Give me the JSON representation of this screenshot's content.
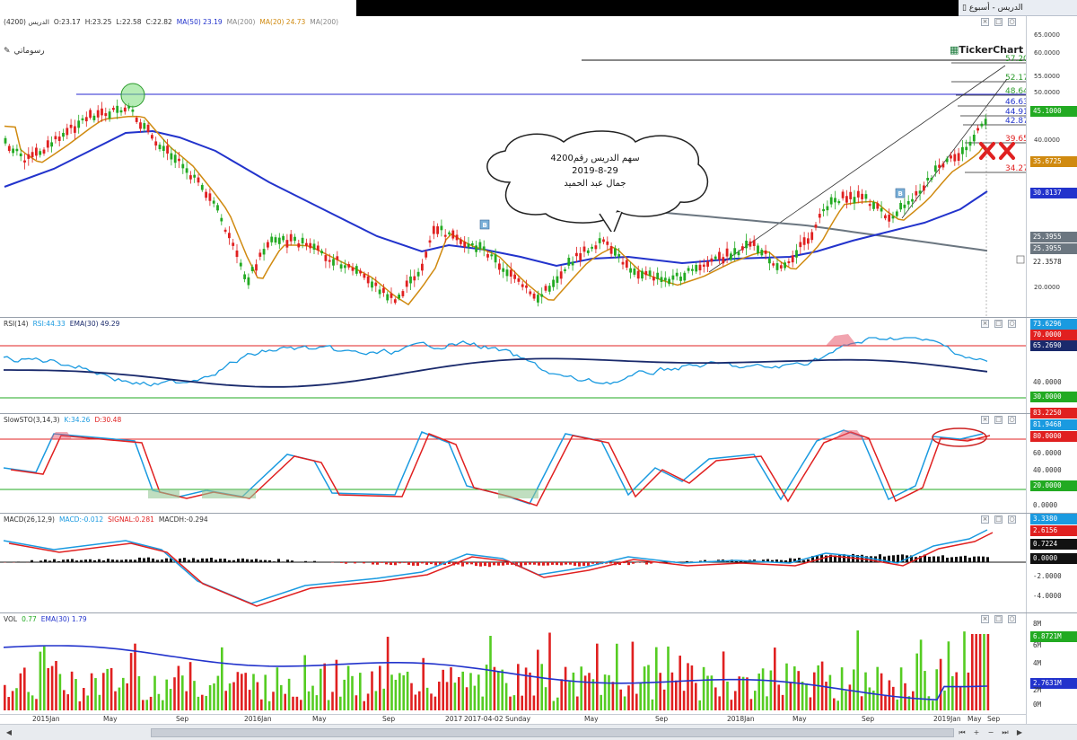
{
  "window": {
    "title": "الدريس - أسبوع",
    "logo": "TickerChart",
    "draw_label": "رسوماتي"
  },
  "price": {
    "header": [
      {
        "label": "الدريس (4200)",
        "color": "#333333"
      },
      {
        "label": "O:23.17",
        "color": "#333333"
      },
      {
        "label": "H:23.25",
        "color": "#333333"
      },
      {
        "label": "L:22.58",
        "color": "#333333"
      },
      {
        "label": "C:22.82",
        "color": "#333333"
      },
      {
        "label": "MA(50) 23.19",
        "color": "#2233cc"
      },
      {
        "label": "MA(200) ",
        "color": "#888888"
      },
      {
        "label": "MA(20) 24.73",
        "color": "#d08a10"
      },
      {
        "label": "MA(200)",
        "color": "#888888"
      }
    ],
    "ticks": [
      "65.0000",
      "60.0000",
      "55.0000",
      "50.0000",
      "45.0000",
      "40.0000",
      "35.0000",
      "30.0000",
      "25.0000",
      "20.0000"
    ],
    "tags": [
      {
        "text": "45.1000",
        "color": "#22aa22"
      },
      {
        "text": "35.6725",
        "color": "#d08a10"
      },
      {
        "text": "30.8137",
        "color": "#2233cc"
      },
      {
        "text": "25.3955",
        "color": "#6b7680"
      },
      {
        "text": "25.3955",
        "color": "#6b7680"
      },
      {
        "text": "22.3578",
        "color": "#ffffff"
      }
    ],
    "fib_levels": [
      "57.20",
      "52.17",
      "48.64",
      "46.63",
      "44.91",
      "42.87",
      "39.65",
      "34.27"
    ],
    "annotation": {
      "line1": "سهم الدريس رقم4200",
      "line2": "2019-8-29",
      "line3": "جمال عبد الحميد"
    },
    "badges": [
      "B",
      "B"
    ]
  },
  "rsi": {
    "header": [
      {
        "label": "RSI(14)",
        "color": "#333333"
      },
      {
        "label": "RSI:44.33",
        "color": "#1a9ae0"
      },
      {
        "label": "EMA(30) 49.29",
        "color": "#1a2a6c"
      }
    ],
    "tags": [
      {
        "text": "73.6296",
        "color": "#1a9ae0"
      },
      {
        "text": "70.0000",
        "color": "#e02020"
      },
      {
        "text": "65.2690",
        "color": "#1a2a6c"
      },
      {
        "text": "40.0000",
        "color": "#ffffff"
      },
      {
        "text": "30.0000",
        "color": "#22aa22"
      }
    ]
  },
  "sto": {
    "header": [
      {
        "label": "SlowSTO(3,14,3)",
        "color": "#333333"
      },
      {
        "label": "K:34.26",
        "color": "#1a9ae0"
      },
      {
        "label": "D:30.48",
        "color": "#e02020"
      }
    ],
    "tags": [
      {
        "text": "83.2250",
        "color": "#e02020"
      },
      {
        "text": "81.9468",
        "color": "#1a9ae0"
      },
      {
        "text": "80.0000",
        "color": "#e02020"
      },
      {
        "text": "60.0000",
        "color": "#ffffff"
      },
      {
        "text": "40.0000",
        "color": "#ffffff"
      },
      {
        "text": "20.0000",
        "color": "#22aa22"
      },
      {
        "text": "0.0000",
        "color": "#ffffff"
      }
    ]
  },
  "macd": {
    "header": [
      {
        "label": "MACD(26,12,9)",
        "color": "#333333"
      },
      {
        "label": "MACD:-0.012",
        "color": "#1a9ae0"
      },
      {
        "label": "SIGNAL:0.281",
        "color": "#e02020"
      },
      {
        "label": "MACDH:-0.294",
        "color": "#333333"
      }
    ],
    "tags": [
      {
        "text": "3.3380",
        "color": "#1a9ae0"
      },
      {
        "text": "2.6156",
        "color": "#e02020"
      },
      {
        "text": "0.7224",
        "color": "#111111"
      },
      {
        "text": "0.0000",
        "color": "#111111"
      },
      {
        "text": "-2.0000",
        "color": "#ffffff"
      },
      {
        "text": "-4.0000",
        "color": "#ffffff"
      }
    ]
  },
  "vol": {
    "header": [
      {
        "label": "VOL",
        "color": "#333333"
      },
      {
        "label": "0.77",
        "color": "#22aa22"
      },
      {
        "label": "EMA(30) 1.79",
        "color": "#2233cc"
      }
    ],
    "tags": [
      {
        "text": "8M",
        "color": "#ffffff"
      },
      {
        "text": "6.8721M",
        "color": "#22aa22"
      },
      {
        "text": "6M",
        "color": "#ffffff"
      },
      {
        "text": "4M",
        "color": "#ffffff"
      },
      {
        "text": "2.7631M",
        "color": "#2233cc"
      },
      {
        "text": "2M",
        "color": "#ffffff"
      },
      {
        "text": "0M",
        "color": "#ffffff"
      }
    ]
  },
  "xaxis": [
    "2015Jan",
    "May",
    "Sep",
    "2016Jan",
    "May",
    "Sep",
    "2017",
    "2017-04-02 Sunday",
    "May",
    "Sep",
    "2018Jan",
    "May",
    "Sep",
    "2019Jan",
    "May",
    "Sep"
  ]
}
